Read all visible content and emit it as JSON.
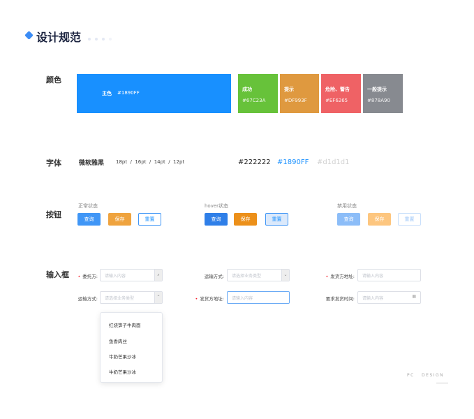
{
  "title": "设计规范",
  "sections": {
    "color": "颜色",
    "font": "字体",
    "button": "按钮",
    "input": "输入框"
  },
  "colors": [
    {
      "label": "主色",
      "hex": "#1890FF"
    },
    {
      "label": "成功",
      "hex": "#67C23A"
    },
    {
      "label": "提示",
      "hex": "#DF993F"
    },
    {
      "label": "危险、警告",
      "hex": "#EF6265"
    },
    {
      "label": "一般提示",
      "hex": "#878A90"
    }
  ],
  "font": {
    "name": "微软雅黑",
    "sizes": "18pt  /  16pt  /  14pt  /  12pt",
    "colors": [
      "#222222",
      "#1890FF",
      "#d1d1d1"
    ]
  },
  "buttons": {
    "states": [
      "正常状态",
      "hover状态",
      "禁用状态"
    ],
    "query": "查询",
    "save": "保存",
    "reset": "重置"
  },
  "inputs": {
    "row1": [
      {
        "label": "委托方:",
        "required": true,
        "placeholder": "请输入内容",
        "icon": "search-icon"
      },
      {
        "label": "运输方式:",
        "required": false,
        "placeholder": "请选择业务类型",
        "icon": "chevron-down-icon"
      },
      {
        "label": "发货方地址:",
        "required": true,
        "placeholder": "请输入内容"
      }
    ],
    "row2": [
      {
        "label": "运输方式:",
        "required": false,
        "placeholder": "请选择业务类型",
        "icon": "chevron-up-icon"
      },
      {
        "label": "发货方地址:",
        "required": true,
        "placeholder": "请输入内容"
      },
      {
        "label": "要求发货时间:",
        "required": false,
        "placeholder": "请输入内容",
        "icon": "calendar-icon"
      }
    ],
    "dropdown": [
      "红烧笋子牛肉面",
      "鱼香肉丝",
      "牛奶芒果沙冰",
      "牛奶芒果沙冰"
    ]
  },
  "footer": "PC   DESIGN"
}
